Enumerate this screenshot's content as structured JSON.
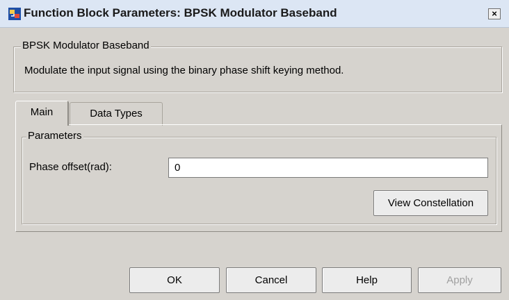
{
  "window": {
    "title": "Function Block Parameters: BPSK Modulator Baseband",
    "close_label": "×"
  },
  "block_group": {
    "legend": "BPSK Modulator Baseband",
    "description": "Modulate the input signal using the binary phase shift keying method."
  },
  "tabs": [
    {
      "label": "Main",
      "active": true
    },
    {
      "label": "Data Types",
      "active": false
    }
  ],
  "parameters": {
    "legend": "Parameters",
    "phase_offset_label": "Phase offset(rad):",
    "phase_offset_value": "0",
    "view_constellation_label": "View Constellation"
  },
  "buttons": {
    "ok": "OK",
    "cancel": "Cancel",
    "help": "Help",
    "apply": "Apply"
  },
  "colors": {
    "window_bg": "#d6d3ce",
    "titlebar_bg": "#dce6f4",
    "disabled_text": "#a0a0a0"
  }
}
